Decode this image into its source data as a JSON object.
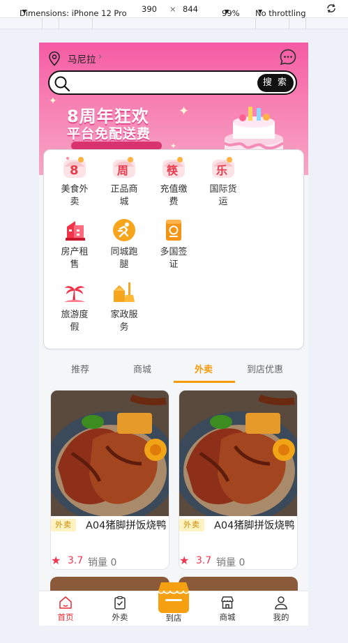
{
  "devtools": {
    "dimensions_label": "Dimensions: iPhone 12 Pro",
    "width": "390",
    "times": "×",
    "height": "844",
    "zoom": "99%",
    "throttling": "No throttling"
  },
  "header": {
    "location": "马尼拉",
    "search_button": "搜 索",
    "search_placeholder": ""
  },
  "banner": {
    "title": "8周年狂欢",
    "subtitle": "平台免配送费"
  },
  "categories": [
    {
      "label": "美食外卖",
      "icon": "food-delivery-icon"
    },
    {
      "label": "正品商城",
      "icon": "mall-icon"
    },
    {
      "label": "充值缴费",
      "icon": "recharge-icon"
    },
    {
      "label": "国际货运",
      "icon": "freight-icon"
    },
    {
      "label": "房产租售",
      "icon": "real-estate-icon"
    },
    {
      "label": "同城跑腿",
      "icon": "errand-runner-icon"
    },
    {
      "label": "多国签证",
      "icon": "visa-passport-icon"
    },
    {
      "label": "旅游度假",
      "icon": "palm-tree-icon"
    },
    {
      "label": "家政服务",
      "icon": "housekeeping-icon"
    }
  ],
  "tabs": [
    {
      "label": "推荐"
    },
    {
      "label": "商城"
    },
    {
      "label": "外卖",
      "active": true
    },
    {
      "label": "到店优惠"
    }
  ],
  "products": [
    {
      "badge": "外卖",
      "name": "A04猪脚拼饭烧鸭",
      "rating": "3.7",
      "sales": "销量 0"
    },
    {
      "badge": "外卖",
      "name": "A04猪脚拼饭烧鸭",
      "rating": "3.7",
      "sales": "销量 0"
    }
  ],
  "nav": [
    {
      "label": "首页",
      "icon": "home-icon",
      "active": true
    },
    {
      "label": "外卖",
      "icon": "clipboard-icon"
    },
    {
      "label": "到店",
      "icon": "store-awning-icon"
    },
    {
      "label": "商城",
      "icon": "shop-icon"
    },
    {
      "label": "我的",
      "icon": "user-icon"
    }
  ],
  "colors": {
    "header_pink": "#f55ba5",
    "accent_orange": "#f59b0b",
    "active_red": "#e52c35",
    "rating_red": "#f0364f"
  }
}
